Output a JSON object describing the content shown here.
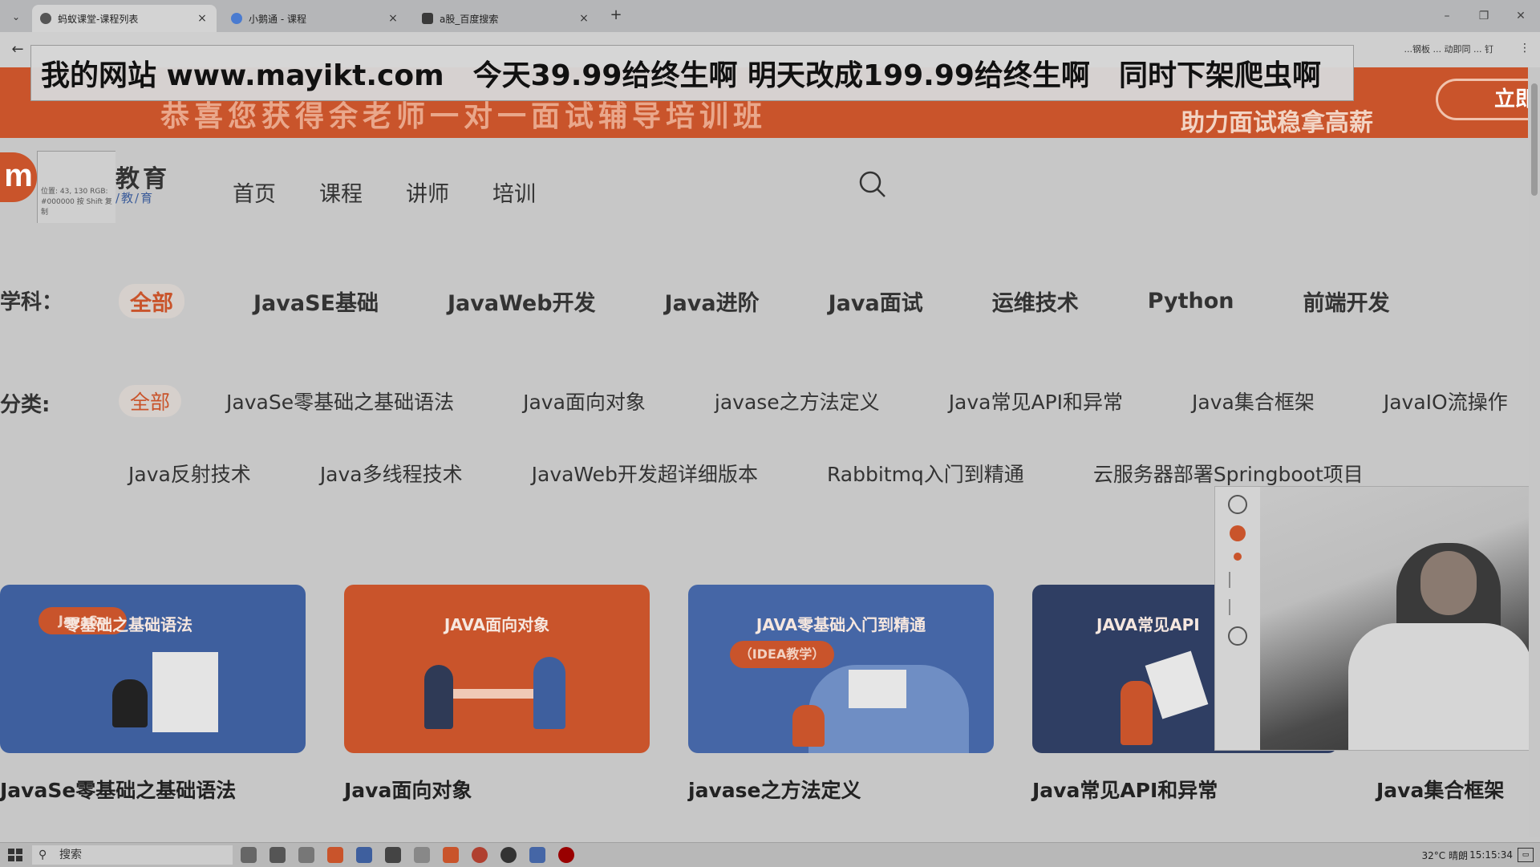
{
  "browser": {
    "tabs": [
      {
        "title": "蚂蚁课堂-课程列表",
        "active": true
      },
      {
        "title": "小鹅通 - 课程",
        "active": false
      },
      {
        "title": "a股_百度搜索",
        "active": false
      }
    ],
    "new_tab": "+",
    "toolbar_text": "...钢板 ... 动即同 ... 钉"
  },
  "promo_overlay": {
    "site": "我的网站 www.mayikt.com",
    "offer": "今天39.99给终生啊 明天改成199.99给终生啊",
    "warning": "同时下架爬虫啊"
  },
  "ad_banner": {
    "headline": "恭喜您获得余老师一对一面试辅导培训班",
    "sub": "助力面试稳拿高薪",
    "button": "立即"
  },
  "site": {
    "logo_main": "教育",
    "logo_sub": "/教/育",
    "picker_tip": "位置: 43, 130 RGB: #000000 按 Shift 复制",
    "nav": [
      "首页",
      "课程",
      "讲师",
      "培训"
    ]
  },
  "filters": {
    "subject_label": "学科：",
    "subjects": [
      "全部",
      "JavaSE基础",
      "JavaWeb开发",
      "Java进阶",
      "Java面试",
      "运维技术",
      "Python",
      "前端开发"
    ],
    "category_label": "分类:",
    "categories_row1": [
      "全部",
      "JavaSe零基础之基础语法",
      "Java面向对象",
      "javase之方法定义",
      "Java常见API和异常",
      "Java集合框架",
      "JavaIO流操作"
    ],
    "categories_row2": [
      "Java反射技术",
      "Java多线程技术",
      "JavaWeb开发超详细版本",
      "Rabbitmq入门到精通",
      "云服务器部署Springboot项目"
    ]
  },
  "courses": [
    {
      "banner": "零基础之基础语法",
      "tag": "JavaSe",
      "title": "JavaSe零基础之基础语法",
      "color": "#3e5f9e"
    },
    {
      "banner": "JAVA面向对象",
      "tag": "",
      "title": "Java面向对象",
      "color": "#c9542b"
    },
    {
      "banner": "JAVA零基础入门到精通",
      "tag": "（IDEA教学）",
      "title": "javase之方法定义",
      "color": "#4566a6"
    },
    {
      "banner": "JAVA常见API",
      "tag": "",
      "title": "Java常见API和异常",
      "color": "#2f3e63"
    }
  ],
  "course_extra_title": "Java集合框架",
  "taskbar": {
    "search": "搜索",
    "weather": "32°C 晴朗",
    "time": "15:15:34"
  }
}
